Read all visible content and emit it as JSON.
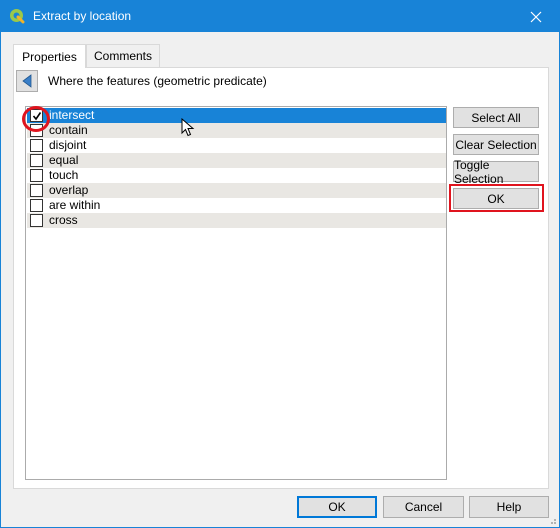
{
  "window": {
    "title": "Extract by location",
    "app_icon": "qgis-icon",
    "titlebar_color": "#1883d7"
  },
  "tabs": [
    {
      "label": "Properties",
      "active": true
    },
    {
      "label": "Comments",
      "active": false
    }
  ],
  "panel": {
    "header": "Where the features (geometric predicate)",
    "back_icon": "back-arrow-icon"
  },
  "predicates": [
    {
      "label": "intersect",
      "checked": true,
      "selected": true
    },
    {
      "label": "contain",
      "checked": false,
      "selected": false
    },
    {
      "label": "disjoint",
      "checked": false,
      "selected": false
    },
    {
      "label": "equal",
      "checked": false,
      "selected": false
    },
    {
      "label": "touch",
      "checked": false,
      "selected": false
    },
    {
      "label": "overlap",
      "checked": false,
      "selected": false
    },
    {
      "label": "are within",
      "checked": false,
      "selected": false
    },
    {
      "label": "cross",
      "checked": false,
      "selected": false
    }
  ],
  "side_buttons": {
    "select_all": "Select All",
    "clear_selection": "Clear Selection",
    "toggle_selection": "Toggle Selection",
    "ok": "OK"
  },
  "footer": {
    "ok": "OK",
    "cancel": "Cancel",
    "help": "Help"
  },
  "annotation_color": "#e0141e"
}
